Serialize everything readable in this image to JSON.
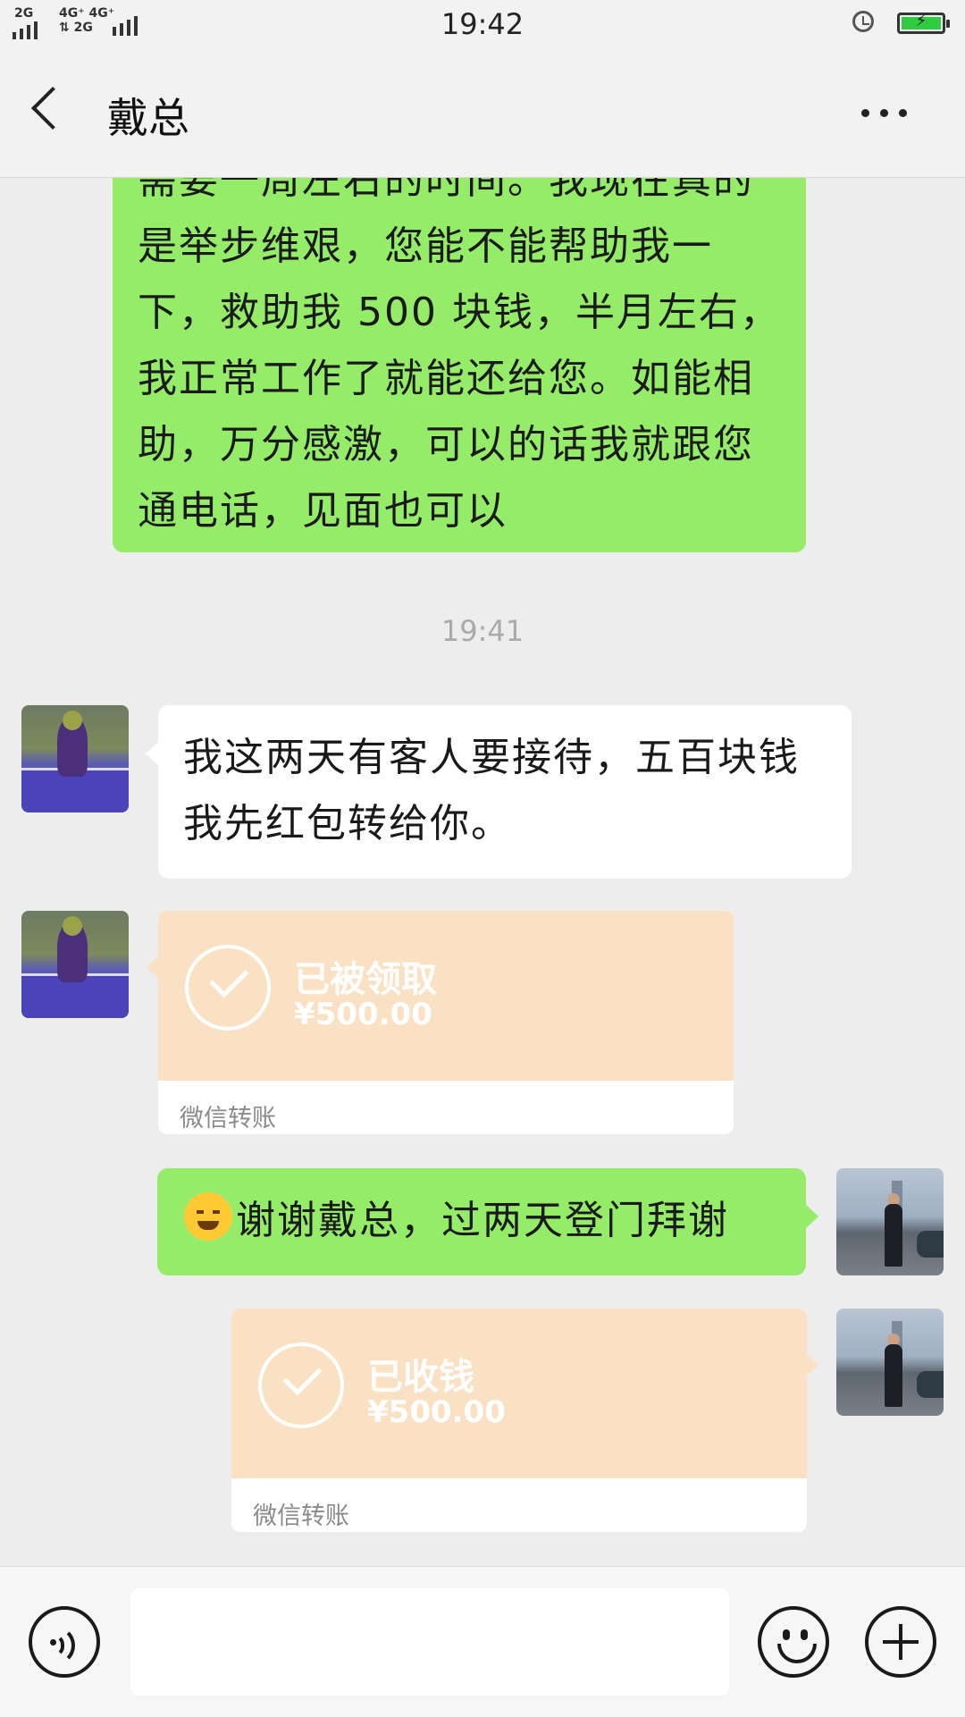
{
  "status_bar": {
    "sim1": "2G",
    "sim2_top": "4G⁺ 4G⁺",
    "sim2_bottom": "⇅ 2G",
    "time": "19:42"
  },
  "header": {
    "title": "戴总"
  },
  "messages": [
    {
      "type": "text",
      "side": "right",
      "text": "需要一周左右的时间。我现在真的是举步维艰，您能不能帮助我一下，救助我 500 块钱，半月左右，我正常工作了就能还给您。如能相助，万分感激，可以的话我就跟您通电话，见面也可以"
    },
    {
      "type": "time",
      "text": "19:41"
    },
    {
      "type": "text",
      "side": "left",
      "text": "我这两天有客人要接待，五百块钱我先红包转给你。"
    },
    {
      "type": "transfer",
      "side": "left",
      "status": "已被领取",
      "amount": "¥500.00",
      "footer": "微信转账"
    },
    {
      "type": "text",
      "side": "right",
      "emoji": "sob-emoji",
      "text": "谢谢戴总，过两天登门拜谢"
    },
    {
      "type": "transfer",
      "side": "right",
      "status": "已收钱",
      "amount": "¥500.00",
      "footer": "微信转账"
    }
  ],
  "input_bar": {
    "placeholder": "",
    "value": ""
  },
  "colors": {
    "my_bubble": "#95ec69",
    "their_bubble": "#ffffff",
    "transfer_card": "#fbe1c3",
    "background": "#ededed"
  }
}
